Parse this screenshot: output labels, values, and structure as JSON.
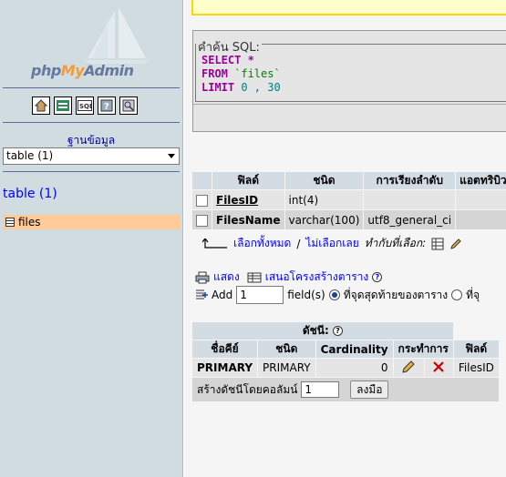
{
  "nav": {
    "brand": {
      "php": "php",
      "my": "My",
      "admin": "Admin"
    },
    "icons": [
      "home-icon",
      "exit-icon",
      "sql-icon",
      "help-icon",
      "docs-icon"
    ],
    "database_label": "ฐานข้อมูล",
    "database_select": "table (1)",
    "table_link": "table (1)",
    "tables": [
      {
        "name": "files"
      }
    ]
  },
  "sql": {
    "legend": "คำค้น SQL:",
    "line1_kw": "SELECT",
    "line1_rest": " *",
    "line2_kw": "FROM",
    "line2_rest": " `files`",
    "line3_kw": "LIMIT",
    "line3_rest": " 0 , 30"
  },
  "fields": {
    "headers": [
      "ฟิลด์",
      "ชนิด",
      "การเรียงลำดับ",
      "แอตทริบิวต์"
    ],
    "rows": [
      {
        "name": "FilesID",
        "type": "int(4)",
        "collation": ""
      },
      {
        "name": "FilesName",
        "type": "varchar(100)",
        "collation": "utf8_general_ci"
      }
    ],
    "select_all": "เลือกทั้งหมด",
    "separator": "/",
    "deselect_all": "ไม่เลือกเลย",
    "with_selected": "ทำกับที่เลือก:"
  },
  "actions": {
    "print": "แสดง",
    "propose": "เสนอโครงสร้างตาราง",
    "add": "Add",
    "add_value": "1",
    "fields_label": "field(s)",
    "at_end": "ที่จุดสุดท้ายของตาราง",
    "at_begin": "ที่จุ"
  },
  "indexes": {
    "title": "ดัชนี:",
    "headers": [
      "ชื่อคีย์",
      "ชนิด",
      "Cardinality",
      "กระทำการ",
      "ฟิลด์"
    ],
    "row": {
      "keyname": "PRIMARY",
      "type": "PRIMARY",
      "cardinality": "0",
      "field": "FilesID"
    },
    "create_label": "สร้างดัชนีโดยคอลัมน์",
    "create_value": "1",
    "go_button": "ลงมือ"
  }
}
